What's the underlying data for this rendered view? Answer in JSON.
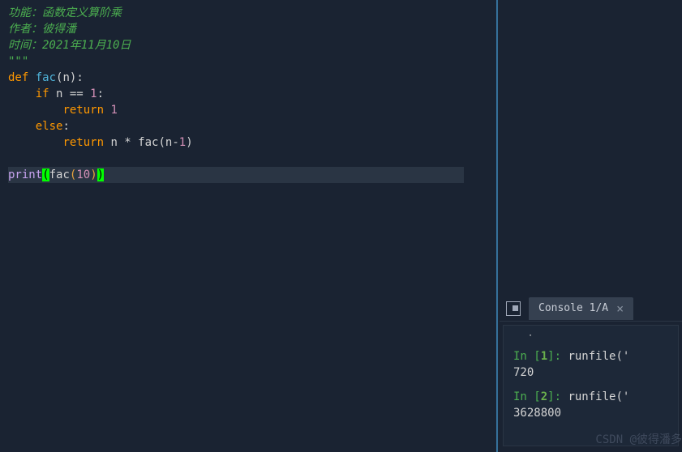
{
  "editor": {
    "comments": {
      "line1": "功能：函数定义算阶乘",
      "line2": "作者：彼得潘",
      "line3": "时间：2021年11月10日",
      "line4": "\"\"\""
    },
    "code": {
      "def": "def",
      "funcname": "fac",
      "param": "n",
      "if": "if",
      "cond": " n == ",
      "one": "1",
      "colon": ":",
      "return": "return",
      "ret1": " 1",
      "else": "else",
      "retn": " n * ",
      "nminus1": "n-",
      "print": "print",
      "ten": "10"
    }
  },
  "console": {
    "tab_label": "Console 1/A",
    "entry1": {
      "prompt": "In [",
      "num": "1",
      "prompt_end": "]: ",
      "cmd": "runfile('",
      "output": "720"
    },
    "entry2": {
      "prompt": "In [",
      "num": "2",
      "prompt_end": "]: ",
      "cmd": "runfile('",
      "output": "3628800"
    }
  },
  "watermark": "CSDN @彼得潘多"
}
